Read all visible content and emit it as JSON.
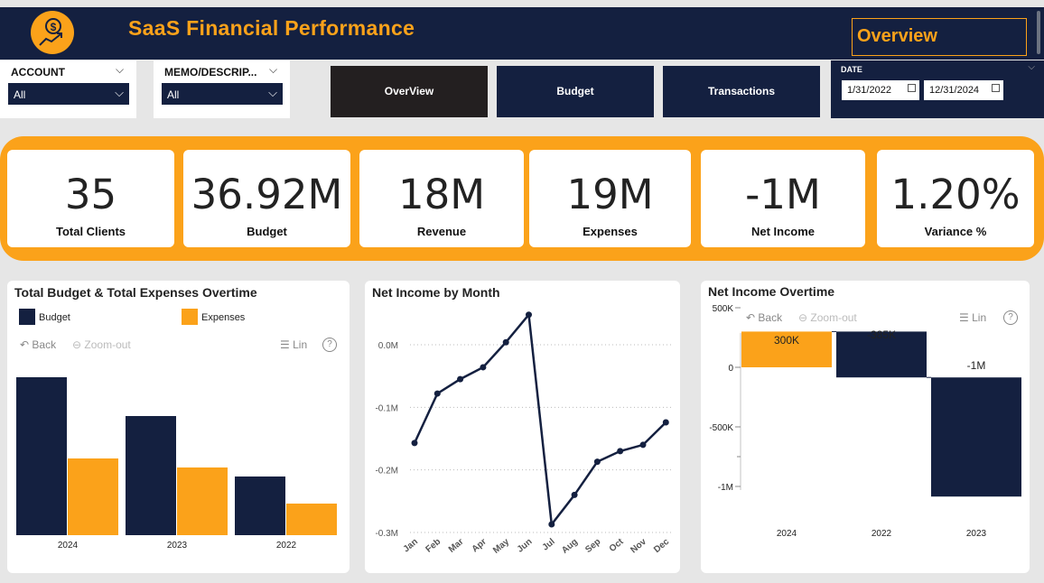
{
  "header": {
    "title": "SaaS Financial Performance",
    "page_indicator": "Overview"
  },
  "filters": {
    "account": {
      "label": "ACCOUNT",
      "value": "All"
    },
    "memo": {
      "label": "MEMO/DESCRIP...",
      "value": "All"
    },
    "date": {
      "label": "DATE",
      "start": "1/31/2022",
      "end": "12/31/2024"
    }
  },
  "nav": {
    "overview": "OverView",
    "budget": "Budget",
    "transactions": "Transactions"
  },
  "kpis": [
    {
      "value": "35",
      "label": "Total Clients"
    },
    {
      "value": "36.92M",
      "label": "Budget"
    },
    {
      "value": "18M",
      "label": "Revenue"
    },
    {
      "value": "19M",
      "label": "Expenses"
    },
    {
      "value": "-1M",
      "label": "Net Income"
    },
    {
      "value": "1.20%",
      "label": "Variance %"
    }
  ],
  "toolbar": {
    "back": "Back",
    "zoom_out": "Zoom-out",
    "lin": "Lin",
    "help": "?"
  },
  "colors": {
    "navy": "#142040",
    "orange": "#fba21a"
  },
  "chart_data": [
    {
      "type": "bar",
      "title": "Total Budget & Total Expenses Overtime",
      "categories": [
        "2024",
        "2023",
        "2022"
      ],
      "series": [
        {
          "name": "Budget",
          "values": [
            17.5,
            13.2,
            6.5
          ],
          "color": "#142040"
        },
        {
          "name": "Expenses",
          "values": [
            8.5,
            7.5,
            3.5
          ],
          "color": "#fba21a"
        }
      ],
      "ylim": [
        0,
        17.5
      ],
      "legend": "top-left"
    },
    {
      "type": "line",
      "title": "Net Income by Month",
      "categories": [
        "Jan",
        "Feb",
        "Mar",
        "Apr",
        "May",
        "Jun",
        "Jul",
        "Aug",
        "Sep",
        "Oct",
        "Nov",
        "Dec"
      ],
      "values": [
        -0.157,
        -0.078,
        -0.055,
        -0.036,
        0.004,
        0.048,
        -0.287,
        -0.24,
        -0.187,
        -0.17,
        -0.16,
        -0.124
      ],
      "yticks": [
        "0.0M",
        "-0.1M",
        "-0.2M",
        "-0.3M"
      ],
      "ytick_values": [
        0,
        -0.1,
        -0.2,
        -0.3
      ],
      "ylim": [
        -0.3,
        0.05
      ]
    },
    {
      "type": "waterfall",
      "title": "Net Income Overtime",
      "categories": [
        "2024",
        "2022",
        "2023"
      ],
      "values": [
        300000,
        -385000,
        -1000000
      ],
      "data_labels": [
        "300K",
        "-385K",
        "-1M"
      ],
      "yticks": [
        "500K",
        "0",
        "-500K",
        "-1M"
      ],
      "ytick_values": [
        500000,
        0,
        -500000,
        -1000000
      ],
      "ylim": [
        -1100000,
        600000
      ],
      "colors": [
        "#fba21a",
        "#142040",
        "#142040"
      ]
    }
  ]
}
